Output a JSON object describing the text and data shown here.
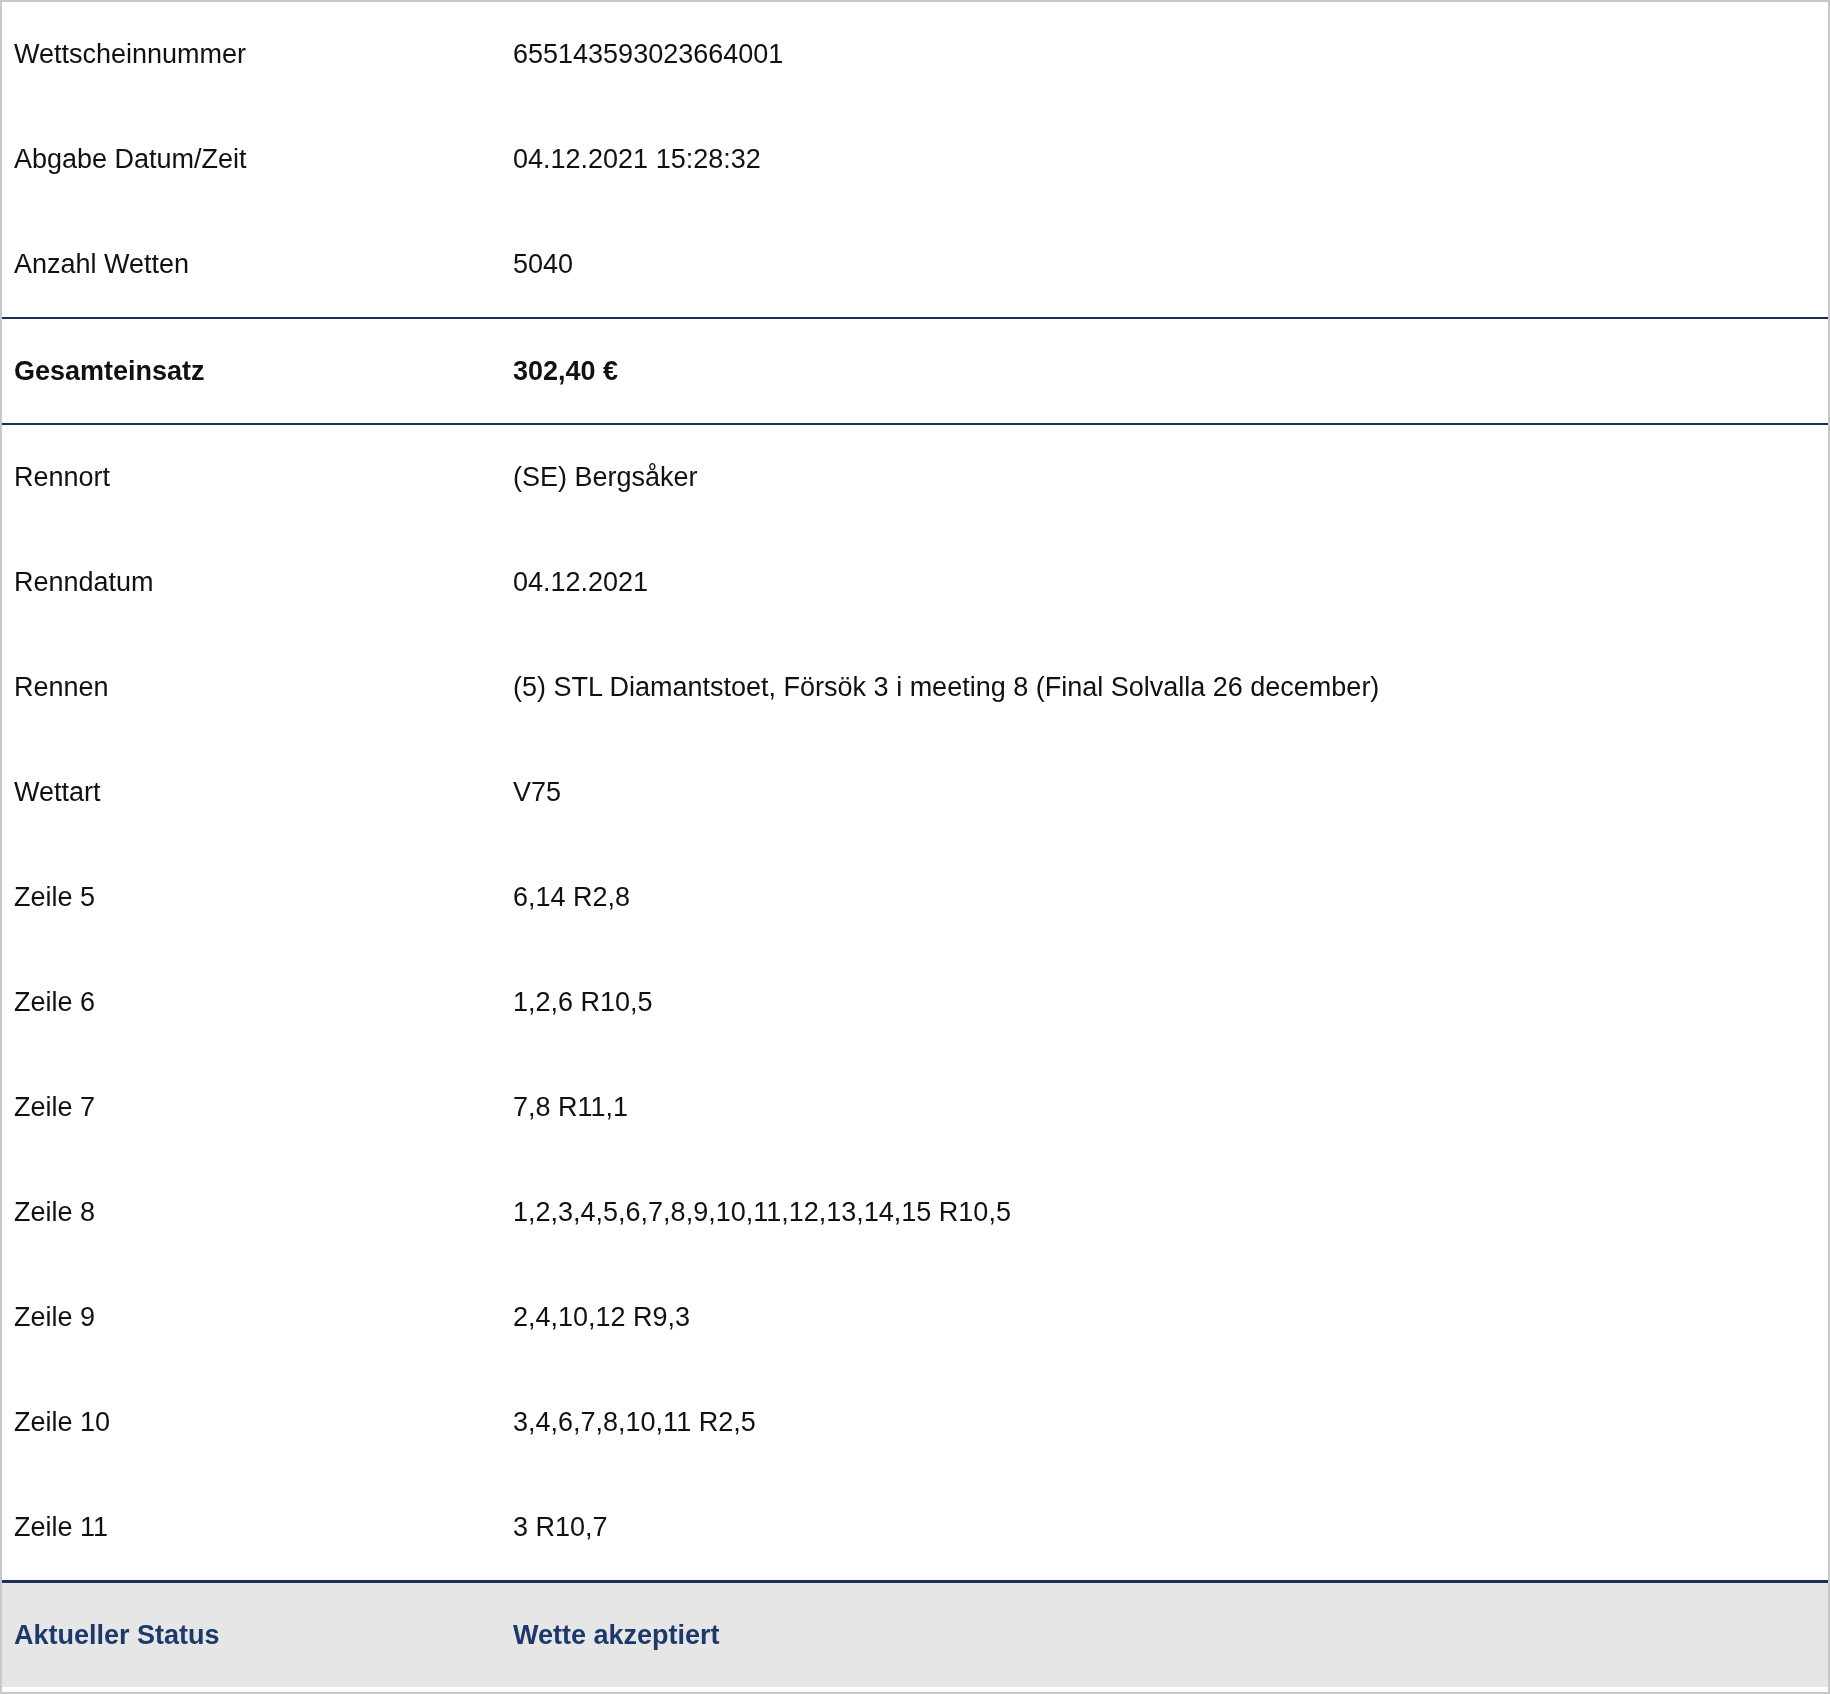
{
  "rows": [
    {
      "kind": "normal",
      "label": "Wettscheinnummer",
      "value": "655143593023664001"
    },
    {
      "kind": "normal",
      "label": "Abgabe Datum/Zeit",
      "value": "04.12.2021 15:28:32"
    },
    {
      "kind": "normal",
      "label": "Anzahl Wetten",
      "value": "5040"
    },
    {
      "kind": "total",
      "label": "Gesamteinsatz",
      "value": "302,40 €"
    },
    {
      "kind": "normal",
      "label": "Rennort",
      "value": "(SE) Bergsåker"
    },
    {
      "kind": "normal",
      "label": "Renndatum",
      "value": "04.12.2021"
    },
    {
      "kind": "normal",
      "label": "Rennen",
      "value": "(5) STL Diamantstoet, Försök 3 i meeting 8 (Final Solvalla 26 december)"
    },
    {
      "kind": "normal",
      "label": "Wettart",
      "value": "V75"
    },
    {
      "kind": "normal",
      "label": "Zeile 5",
      "value": "6,14 R2,8"
    },
    {
      "kind": "normal",
      "label": "Zeile 6",
      "value": "1,2,6 R10,5"
    },
    {
      "kind": "normal",
      "label": "Zeile 7",
      "value": "7,8 R11,1"
    },
    {
      "kind": "normal",
      "label": "Zeile 8",
      "value": "1,2,3,4,5,6,7,8,9,10,11,12,13,14,15 R10,5"
    },
    {
      "kind": "normal",
      "label": "Zeile 9",
      "value": "2,4,10,12 R9,3"
    },
    {
      "kind": "normal",
      "label": "Zeile 10",
      "value": "3,4,6,7,8,10,11 R2,5"
    },
    {
      "kind": "normal",
      "label": "Zeile 11",
      "value": "3 R10,7"
    },
    {
      "kind": "status",
      "label": "Aktueller Status",
      "value": "Wette akzeptiert"
    }
  ]
}
